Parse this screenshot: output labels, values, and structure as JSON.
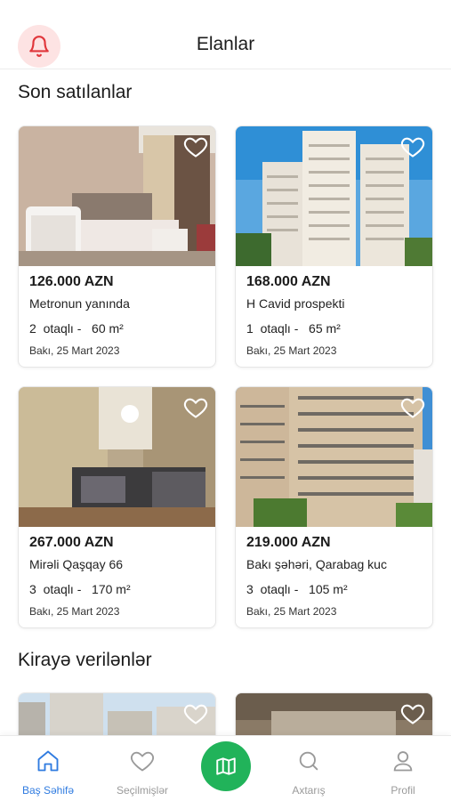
{
  "header": {
    "title": "Elanlar",
    "notification_icon": "bell-icon",
    "accent_color": "#e0363b"
  },
  "sections": {
    "sold_title": "Son satılanlar",
    "rent_title": "Kirayə verilənlər"
  },
  "sold_listings": [
    {
      "price": "126.000 AZN",
      "address": "Metronun yanında",
      "rooms": "2  otaqlı -   60 m²",
      "date": "Bakı, 25 Mart 2023",
      "favorite_icon": "heart-outline-icon"
    },
    {
      "price": "168.000 AZN",
      "address": "H Cavid prospekti",
      "rooms": "1  otaqlı -   65 m²",
      "date": "Bakı, 25 Mart 2023",
      "favorite_icon": "heart-outline-icon"
    },
    {
      "price": "267.000 AZN",
      "address": "Mirəli Qaşqay 66",
      "rooms": "3  otaqlı -   170 m²",
      "date": "Bakı, 25 Mart 2023",
      "favorite_icon": "heart-outline-icon"
    },
    {
      "price": "219.000 AZN",
      "address": "Bakı şəhəri, Qarabag kuc",
      "rooms": "3  otaqlı -   105 m²",
      "date": "Bakı, 25 Mart 2023",
      "favorite_icon": "heart-outline-icon"
    }
  ],
  "bottom_nav": {
    "items": [
      {
        "label": "Baş Səhifə",
        "icon": "home-icon",
        "active": true
      },
      {
        "label": "Seçilmişlər",
        "icon": "heart-icon",
        "active": false
      },
      {
        "label": "",
        "icon": "map-icon",
        "active": false
      },
      {
        "label": "Axtarış",
        "icon": "search-icon",
        "active": false
      },
      {
        "label": "Profil",
        "icon": "user-icon",
        "active": false
      }
    ],
    "active_color": "#2f7be0",
    "inactive_color": "#9a9a9a",
    "map_button_color": "#21b35a"
  }
}
